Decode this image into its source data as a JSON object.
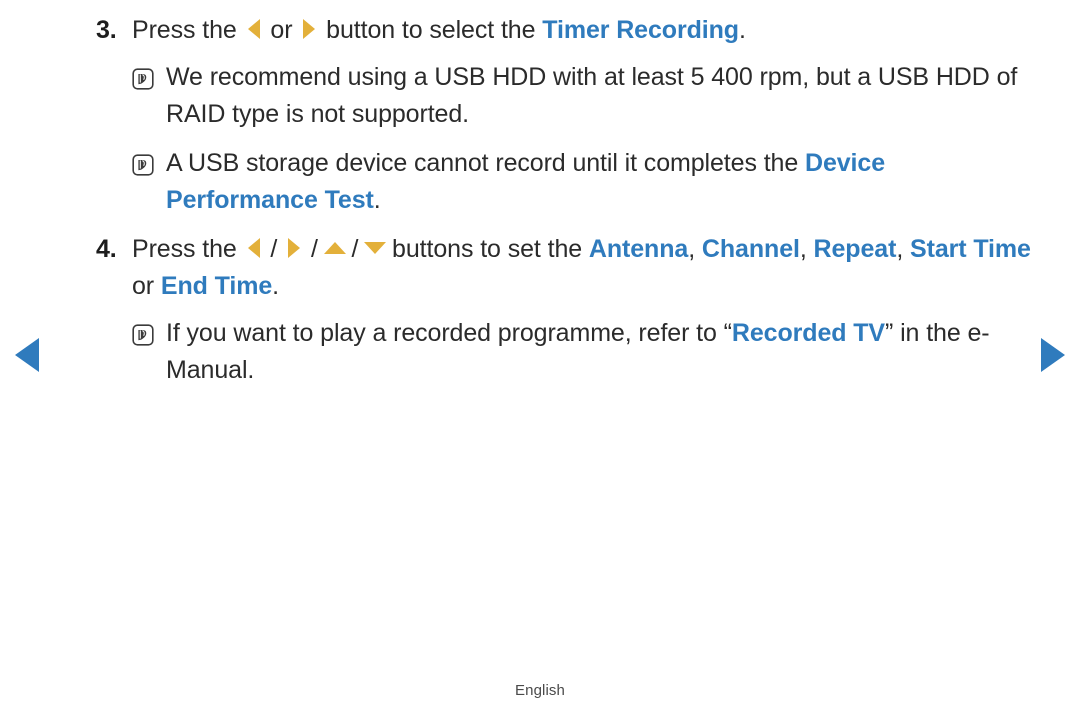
{
  "page": {
    "background_color": "#ffffff",
    "text_color": "#2b2b2b",
    "accent_blue": "#2f7bbd",
    "accent_gold": "#e3b03a",
    "footer_label": "English"
  },
  "nav": {
    "prev_icon": "triangle-left-icon",
    "next_icon": "triangle-right-icon",
    "prev_label": "Previous page",
    "next_label": "Next page"
  },
  "steps": [
    {
      "number": "3.",
      "segments": [
        {
          "type": "text",
          "value": "Press the "
        },
        {
          "type": "arrow",
          "value": "left"
        },
        {
          "type": "text",
          "value": " or "
        },
        {
          "type": "arrow",
          "value": "right"
        },
        {
          "type": "text",
          "value": " button to select the "
        },
        {
          "type": "highlight",
          "value": "Timer Recording"
        },
        {
          "type": "text",
          "value": "."
        }
      ],
      "text_plain": "Press the ◀ or ▶ button to select the Timer Recording.",
      "notes": [
        {
          "icon": "note-pen-icon",
          "segments": [
            {
              "type": "text",
              "value": "We recommend using a USB HDD with at least 5 400 rpm, but a USB HDD of RAID type is not supported."
            }
          ],
          "text_plain": "We recommend using a USB HDD with at least 5 400 rpm, but a USB HDD of RAID type is not supported."
        },
        {
          "icon": "note-pen-icon",
          "segments": [
            {
              "type": "text",
              "value": "A USB storage device cannot record until it completes the "
            },
            {
              "type": "highlight",
              "value": "Device Performance Test"
            },
            {
              "type": "text",
              "value": "."
            }
          ],
          "text_plain": "A USB storage device cannot record until it completes the Device Performance Test."
        }
      ]
    },
    {
      "number": "4.",
      "segments": [
        {
          "type": "text",
          "value": "Press the "
        },
        {
          "type": "arrow",
          "value": "left"
        },
        {
          "type": "text",
          "value": " / "
        },
        {
          "type": "arrow",
          "value": "right"
        },
        {
          "type": "text",
          "value": " / "
        },
        {
          "type": "arrow",
          "value": "up"
        },
        {
          "type": "text",
          "value": " / "
        },
        {
          "type": "arrow",
          "value": "down"
        },
        {
          "type": "text",
          "value": " buttons to set the "
        },
        {
          "type": "highlight",
          "value": "Antenna"
        },
        {
          "type": "text",
          "value": ", "
        },
        {
          "type": "highlight",
          "value": "Channel"
        },
        {
          "type": "text",
          "value": ", "
        },
        {
          "type": "highlight",
          "value": "Repeat"
        },
        {
          "type": "text",
          "value": ", "
        },
        {
          "type": "highlight",
          "value": "Start Time"
        },
        {
          "type": "text",
          "value": " or "
        },
        {
          "type": "highlight",
          "value": "End Time"
        },
        {
          "type": "text",
          "value": "."
        }
      ],
      "text_plain": "Press the ◀ / ▶ / ▲ / ▼ buttons to set the Antenna, Channel, Repeat, Start Time or End Time.",
      "notes": [
        {
          "icon": "note-pen-icon",
          "segments": [
            {
              "type": "text",
              "value": "If you want to play a recorded programme, refer to “"
            },
            {
              "type": "highlight",
              "value": "Recorded TV"
            },
            {
              "type": "text",
              "value": "” in the e-Manual."
            }
          ],
          "text_plain": "If you want to play a recorded programme, refer to “Recorded TV” in the e-Manual."
        }
      ]
    }
  ]
}
